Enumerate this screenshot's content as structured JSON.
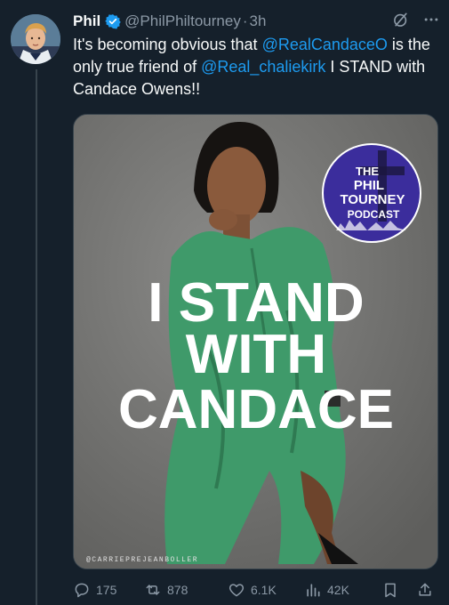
{
  "tweet": {
    "display_name": "Phil",
    "handle": "@PhilPhiltourney",
    "separator": "·",
    "time": "3h",
    "text_part1": "It's becoming obvious that ",
    "mention1": "@RealCandaceO",
    "text_part2": " is the only true friend of ",
    "mention2": "@Real_chaliekirk",
    "text_part3": " I STAND with Candace Owens!!",
    "more_icon": "more-horizontal-icon",
    "grok_icon": "grok-icon",
    "verified_icon": "verified-badge-icon"
  },
  "media": {
    "headline_line1": "I STAND",
    "headline_line2": "WITH",
    "headline_line3": "CANDACE",
    "watermark": "@CARRIEPREJEANBOLLER",
    "logo_line1": "THE",
    "logo_line2": "PHIL",
    "logo_line3": "TOURNEY",
    "logo_line4": "PODCAST"
  },
  "actions": {
    "replies": "175",
    "reposts": "878",
    "likes": "6.1K",
    "views": "42K"
  },
  "colors": {
    "background": "#15202b",
    "accent": "#1d9bf0",
    "muted": "#8b98a5",
    "dress": "#3f9a6a",
    "logo_bg": "#3b2d9c"
  }
}
